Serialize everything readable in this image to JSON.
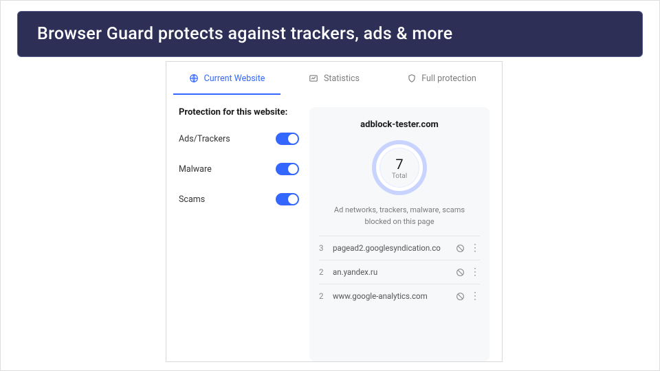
{
  "banner": {
    "text": "Browser Guard protects against trackers, ads & more"
  },
  "tabs": {
    "current": "Current Website",
    "stats": "Statistics",
    "full": "Full protection"
  },
  "protection": {
    "title": "Protection for this website:",
    "toggles": {
      "ads": "Ads/Trackers",
      "malware": "Malware",
      "scams": "Scams"
    }
  },
  "summary": {
    "domain": "adblock-tester.com",
    "total_count": "7",
    "total_label": "Total",
    "description": "Ad networks, trackers, malware, scams blocked on this page"
  },
  "blocked": [
    {
      "count": "3",
      "host": "pagead2.googlesyndication.co"
    },
    {
      "count": "2",
      "host": "an.yandex.ru"
    },
    {
      "count": "2",
      "host": "www.google-analytics.com"
    }
  ]
}
